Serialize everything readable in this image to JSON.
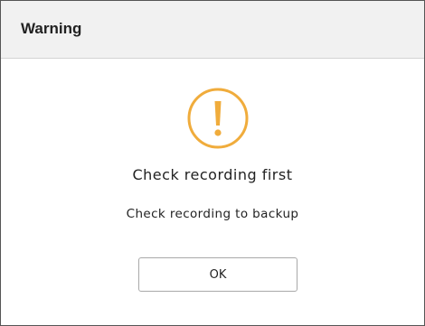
{
  "dialog": {
    "title": "Warning",
    "icon": "warning-exclamation-icon",
    "message": "Check recording first",
    "detail": "Check recording to backup",
    "ok_label": "OK"
  },
  "colors": {
    "accent": "#f0ac3c",
    "titlebar": "#f1f1f1"
  }
}
